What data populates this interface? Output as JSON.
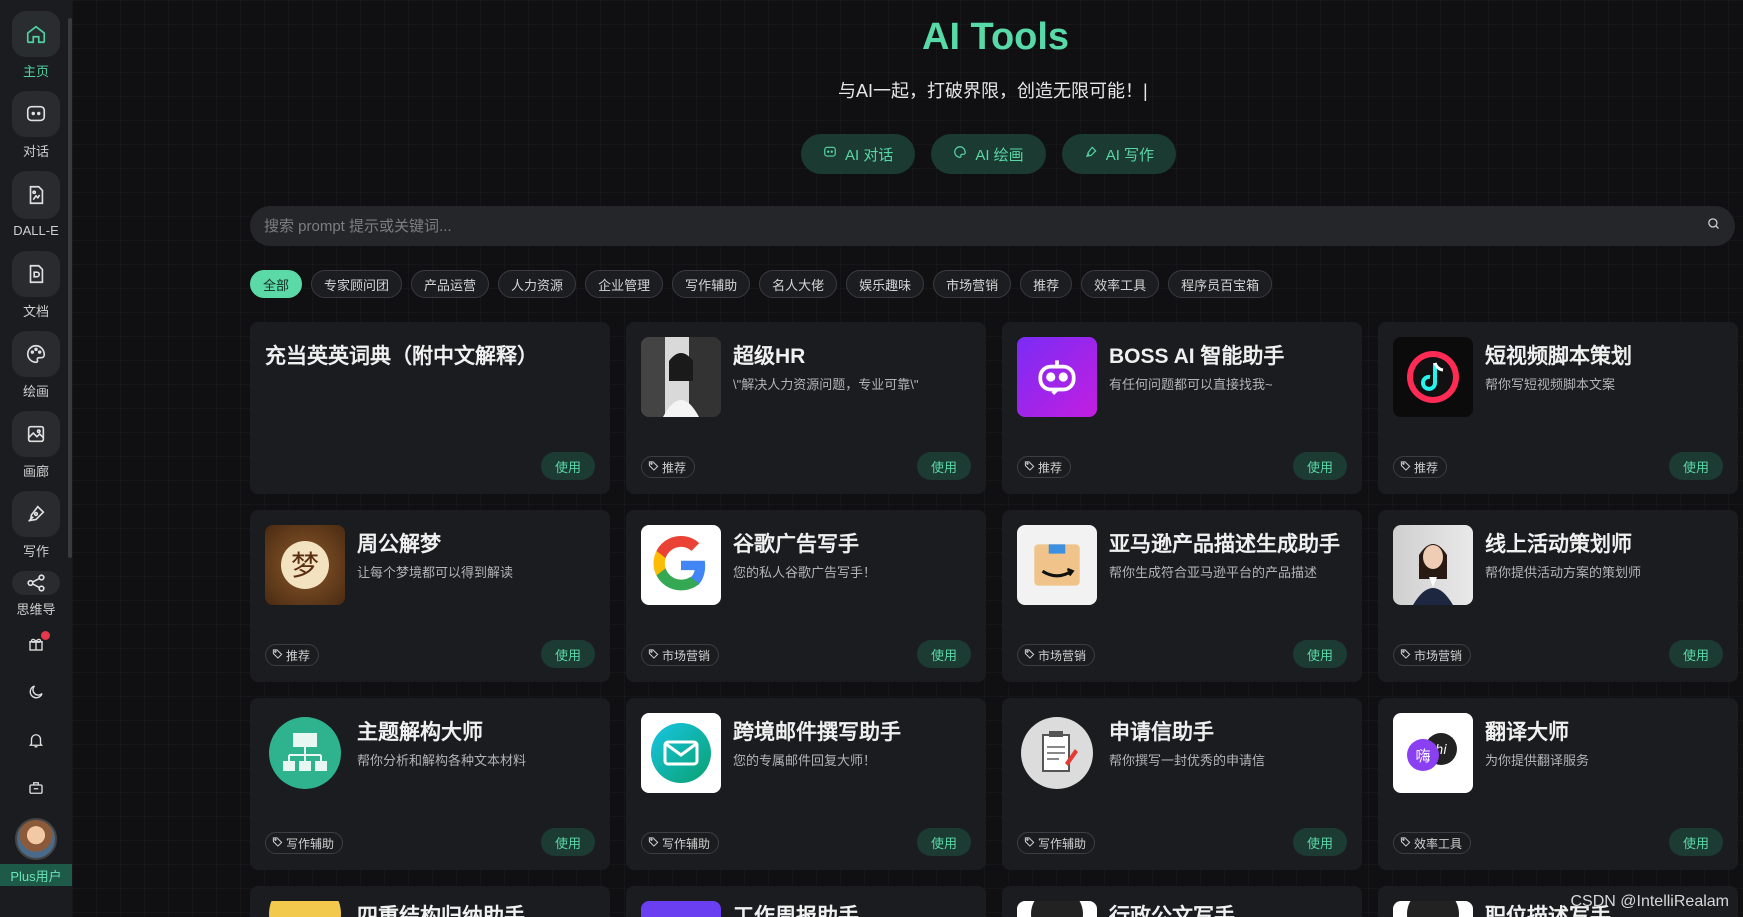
{
  "sidebar": {
    "items": [
      {
        "label": "主页",
        "icon": "home-icon",
        "active": true
      },
      {
        "label": "对话",
        "icon": "chat-icon"
      },
      {
        "label": "DALL-E",
        "icon": "image-file-icon"
      },
      {
        "label": "文档",
        "icon": "document-icon"
      },
      {
        "label": "绘画",
        "icon": "palette-icon"
      },
      {
        "label": "画廊",
        "icon": "gallery-icon"
      },
      {
        "label": "写作",
        "icon": "pen-icon"
      },
      {
        "label": "思维导",
        "icon": "mindmap-icon"
      }
    ],
    "utilities": [
      "gift-icon",
      "moon-icon",
      "bell-icon",
      "toolbox-icon"
    ],
    "user_label": "Plus用户"
  },
  "header": {
    "title": "AI Tools",
    "subtitle": "与AI一起，打破界限，创造无限可能！|",
    "buttons": [
      {
        "label": "AI 对话",
        "icon": "chat-icon"
      },
      {
        "label": "AI 绘画",
        "icon": "palette-icon"
      },
      {
        "label": "AI 写作",
        "icon": "pen-icon"
      }
    ]
  },
  "search": {
    "placeholder": "搜索 prompt 提示或关键词..."
  },
  "categories": [
    "全部",
    "专家顾问团",
    "产品运营",
    "人力资源",
    "企业管理",
    "写作辅助",
    "名人大佬",
    "娱乐趣味",
    "市场营销",
    "推荐",
    "效率工具",
    "程序员百宝箱"
  ],
  "active_category": "全部",
  "cards": [
    {
      "title": "充当英英词典（附中文解释）",
      "desc": "",
      "tag": "",
      "thumb": "none",
      "use_label": "使用"
    },
    {
      "title": "超级HR",
      "desc": "\\\"解决人力资源问题，专业可靠\\\"",
      "tag": "推荐",
      "thumb": "hr-portrait",
      "use_label": "使用"
    },
    {
      "title": "BOSS AI 智能助手",
      "desc": "有任何问题都可以直接找我~",
      "tag": "推荐",
      "thumb": "robot",
      "use_label": "使用"
    },
    {
      "title": "短视频脚本策划",
      "desc": "帮你写短视频脚本文案",
      "tag": "推荐",
      "thumb": "tiktok",
      "use_label": "使用"
    },
    {
      "title": "周公解梦",
      "desc": "让每个梦境都可以得到解读",
      "tag": "推荐",
      "thumb": "dream",
      "use_label": "使用"
    },
    {
      "title": "谷歌广告写手",
      "desc": "您的私人谷歌广告写手！",
      "tag": "市场营销",
      "thumb": "google",
      "use_label": "使用"
    },
    {
      "title": "亚马逊产品描述生成助手",
      "desc": "帮你生成符合亚马逊平台的产品描述",
      "tag": "市场营销",
      "thumb": "amazon",
      "use_label": "使用"
    },
    {
      "title": "线上活动策划师",
      "desc": "帮你提供活动方案的策划师",
      "tag": "市场营销",
      "thumb": "planner-portrait",
      "use_label": "使用"
    },
    {
      "title": "主题解构大师",
      "desc": "帮你分析和解构各种文本材料",
      "tag": "写作辅助",
      "thumb": "structure",
      "use_label": "使用"
    },
    {
      "title": "跨境邮件撰写助手",
      "desc": "您的专属邮件回复大师！",
      "tag": "写作辅助",
      "thumb": "mail",
      "use_label": "使用"
    },
    {
      "title": "申请信助手",
      "desc": "帮你撰写一封优秀的申请信",
      "tag": "写作辅助",
      "thumb": "letter",
      "use_label": "使用"
    },
    {
      "title": "翻译大师",
      "desc": "为你提供翻译服务",
      "tag": "效率工具",
      "thumb": "translate",
      "use_label": "使用"
    },
    {
      "title": "四重结构归纳助手",
      "desc": "",
      "tag": "",
      "thumb": "partial-yellow",
      "use_label": ""
    },
    {
      "title": "工作周报助手",
      "desc": "",
      "tag": "",
      "thumb": "partial-purple",
      "use_label": ""
    },
    {
      "title": "行政公文写手",
      "desc": "",
      "tag": "",
      "thumb": "partial-white",
      "use_label": ""
    },
    {
      "title": "职位描述写手",
      "desc": "",
      "tag": "",
      "thumb": "partial-white",
      "use_label": ""
    }
  ],
  "watermark": "CSDN @IntelliRealam",
  "colors": {
    "accent": "#57d9a8",
    "background": "#101012",
    "card": "#1b1c20"
  }
}
